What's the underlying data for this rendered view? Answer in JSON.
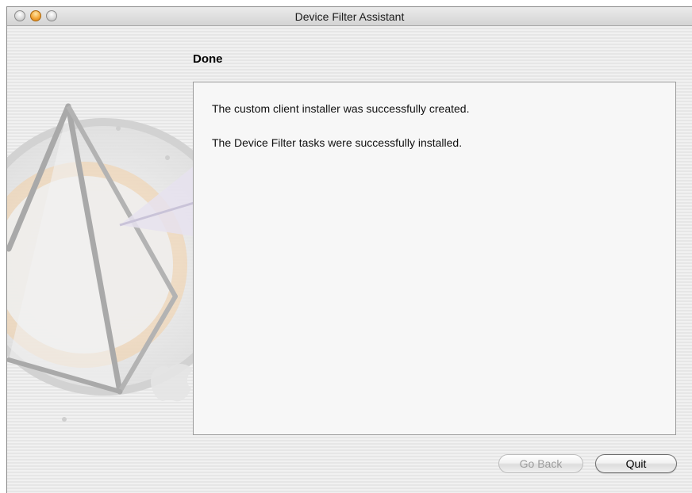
{
  "window": {
    "title": "Device Filter Assistant"
  },
  "traffic_lights": {
    "close_icon": "close-icon",
    "minimize_icon": "minimize-icon",
    "zoom_icon": "zoom-icon"
  },
  "page": {
    "heading": "Done",
    "messages": [
      "The custom client installer was successfully created.",
      "The Device Filter tasks were successfully installed."
    ]
  },
  "buttons": {
    "go_back_label": "Go Back",
    "go_back_enabled": false,
    "quit_label": "Quit"
  },
  "colors": {
    "accent_orange": "#f3a73a",
    "window_background": "#ececec",
    "content_background": "#f7f7f7"
  },
  "watermark": {
    "icon": "assistant-watermark-icon"
  }
}
